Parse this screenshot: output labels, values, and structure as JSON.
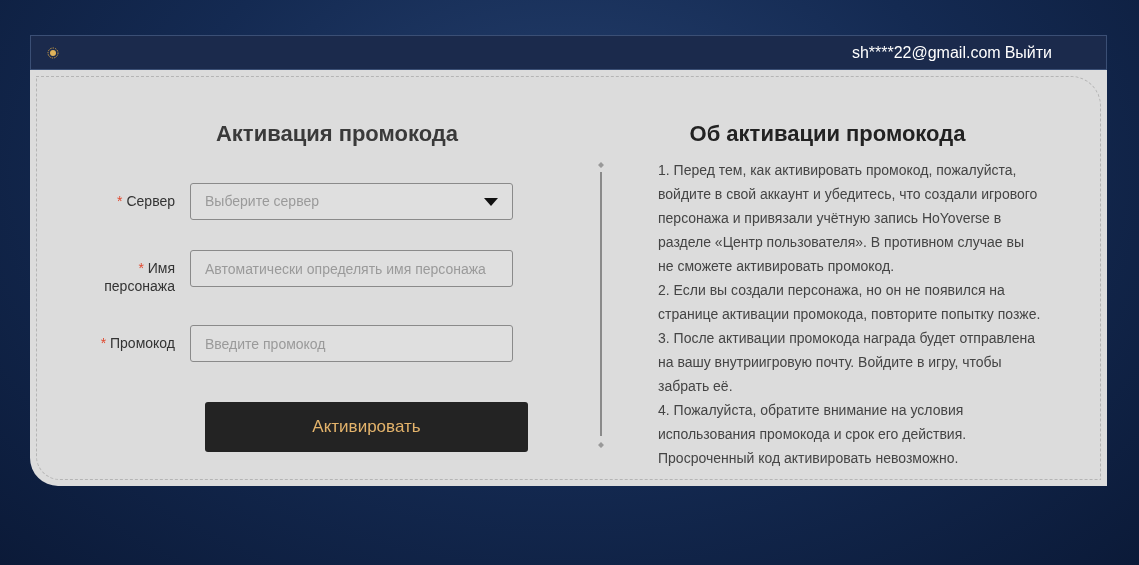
{
  "header": {
    "user": "sh****22@gmail.com",
    "logout": "Выйти"
  },
  "form": {
    "title": "Активация промокода",
    "fields": [
      {
        "kind": "select",
        "required_mark": "*",
        "label": "Сервер",
        "placeholder": "Выберите сервер"
      },
      {
        "kind": "text",
        "required_mark": "*",
        "label": "Имя персонажа",
        "placeholder": "Автоматически определять имя персонажа"
      },
      {
        "kind": "text",
        "required_mark": "*",
        "label": "Промокод",
        "placeholder": "Введите промокод"
      }
    ],
    "submit": "Активировать"
  },
  "info": {
    "title": "Об активации промокода",
    "paragraphs": [
      "1. Перед тем, как активировать промокод, пожалуйста, войдите в свой аккаунт и убедитесь, что создали игрового персонажа и привязали учётную запись HoYoverse в разделе «Центр пользователя». В противном случае вы не сможете активировать промокод.",
      "2. Если вы создали персонажа, но он не появился на странице активации промокода, повторите попытку позже.",
      "3. После активации промокода награда будет отправлена на вашу внутриигровую почту. Войдите в игру, чтобы забрать её.",
      "4. Пожалуйста, обратите внимание на условия использования промокода и срок его действия. Просроченный код активировать невозможно."
    ]
  }
}
